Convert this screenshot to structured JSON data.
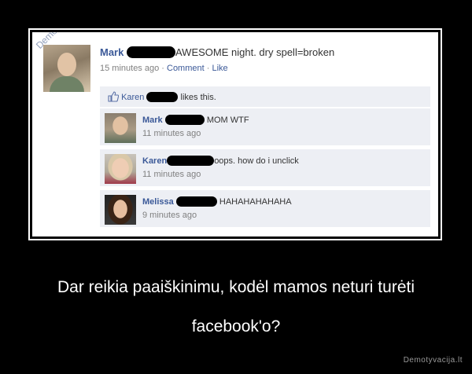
{
  "post": {
    "author": "Mark",
    "text": "AWESOME night. dry spell=broken",
    "time": "15 minutes ago",
    "sep1": " · ",
    "comment_link": "Comment",
    "sep2": " · ",
    "like_link": "Like"
  },
  "likes": {
    "name": "Karen",
    "text": "likes this."
  },
  "comments": [
    {
      "name": "Mark",
      "text": "MOM WTF",
      "time": "11 minutes ago"
    },
    {
      "name": "Karen",
      "text": "oops. how do i unclick",
      "time": "11 minutes ago"
    },
    {
      "name": "Melissa",
      "text": "HAHAHAHAHAHA",
      "time": "9 minutes ago"
    }
  ],
  "watermark": "Demotyvacija.lt",
  "caption": {
    "line1": "Dar reikia paaiškinimu, kodėl mamos neturi turėti",
    "line2": "facebook'o?"
  },
  "site": "Demotyvacija.lt",
  "colors": {
    "facebook_blue": "#3b5998",
    "comment_bg": "#edeff4",
    "meta_gray": "#808080"
  }
}
